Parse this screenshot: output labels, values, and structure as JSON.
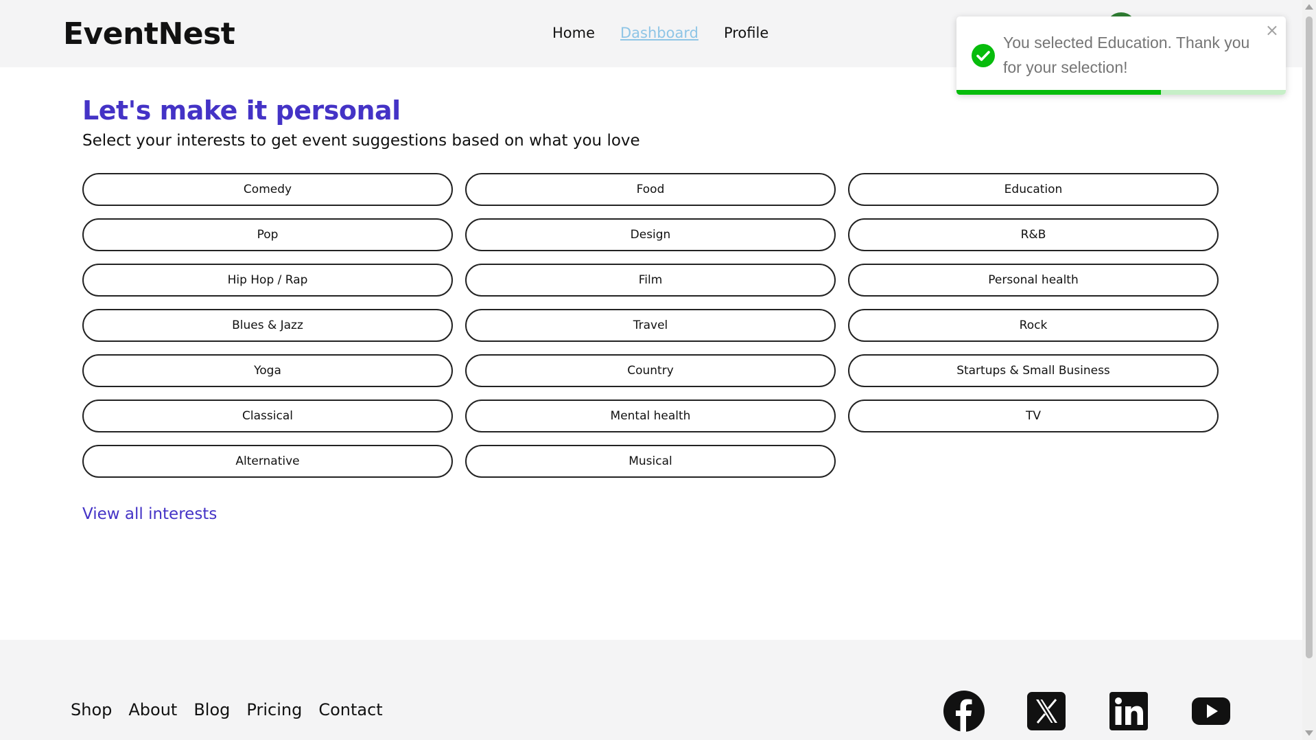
{
  "brand": {
    "logo": "EventNest"
  },
  "nav": {
    "home": "Home",
    "dashboard": "Dashboard",
    "profile": "Profile"
  },
  "main": {
    "title": "Let's make it personal",
    "subtitle": "Select your interests to get event suggestions based on what you love",
    "interests": [
      "Comedy",
      "Food",
      "Education",
      "Pop",
      "Design",
      "R&B",
      "Hip Hop / Rap",
      "Film",
      "Personal health",
      "Blues & Jazz",
      "Travel",
      "Rock",
      "Yoga",
      "Country",
      "Startups & Small Business",
      "Classical",
      "Mental health",
      "TV",
      "Alternative",
      "Musical"
    ],
    "view_all": "View all interests"
  },
  "toast": {
    "message": "You selected Education. Thank you for your selection!",
    "close": "×",
    "progress": 0.62,
    "accent": "#07bc0c"
  },
  "footer": {
    "links": [
      "Shop",
      "About",
      "Blog",
      "Pricing",
      "Contact"
    ],
    "socials": [
      "facebook-icon",
      "x-icon",
      "linkedin-icon",
      "youtube-icon"
    ]
  },
  "colors": {
    "accent": "#4433c6",
    "nav_active": "#8ec5e6",
    "avatar": "#2e7d32"
  }
}
